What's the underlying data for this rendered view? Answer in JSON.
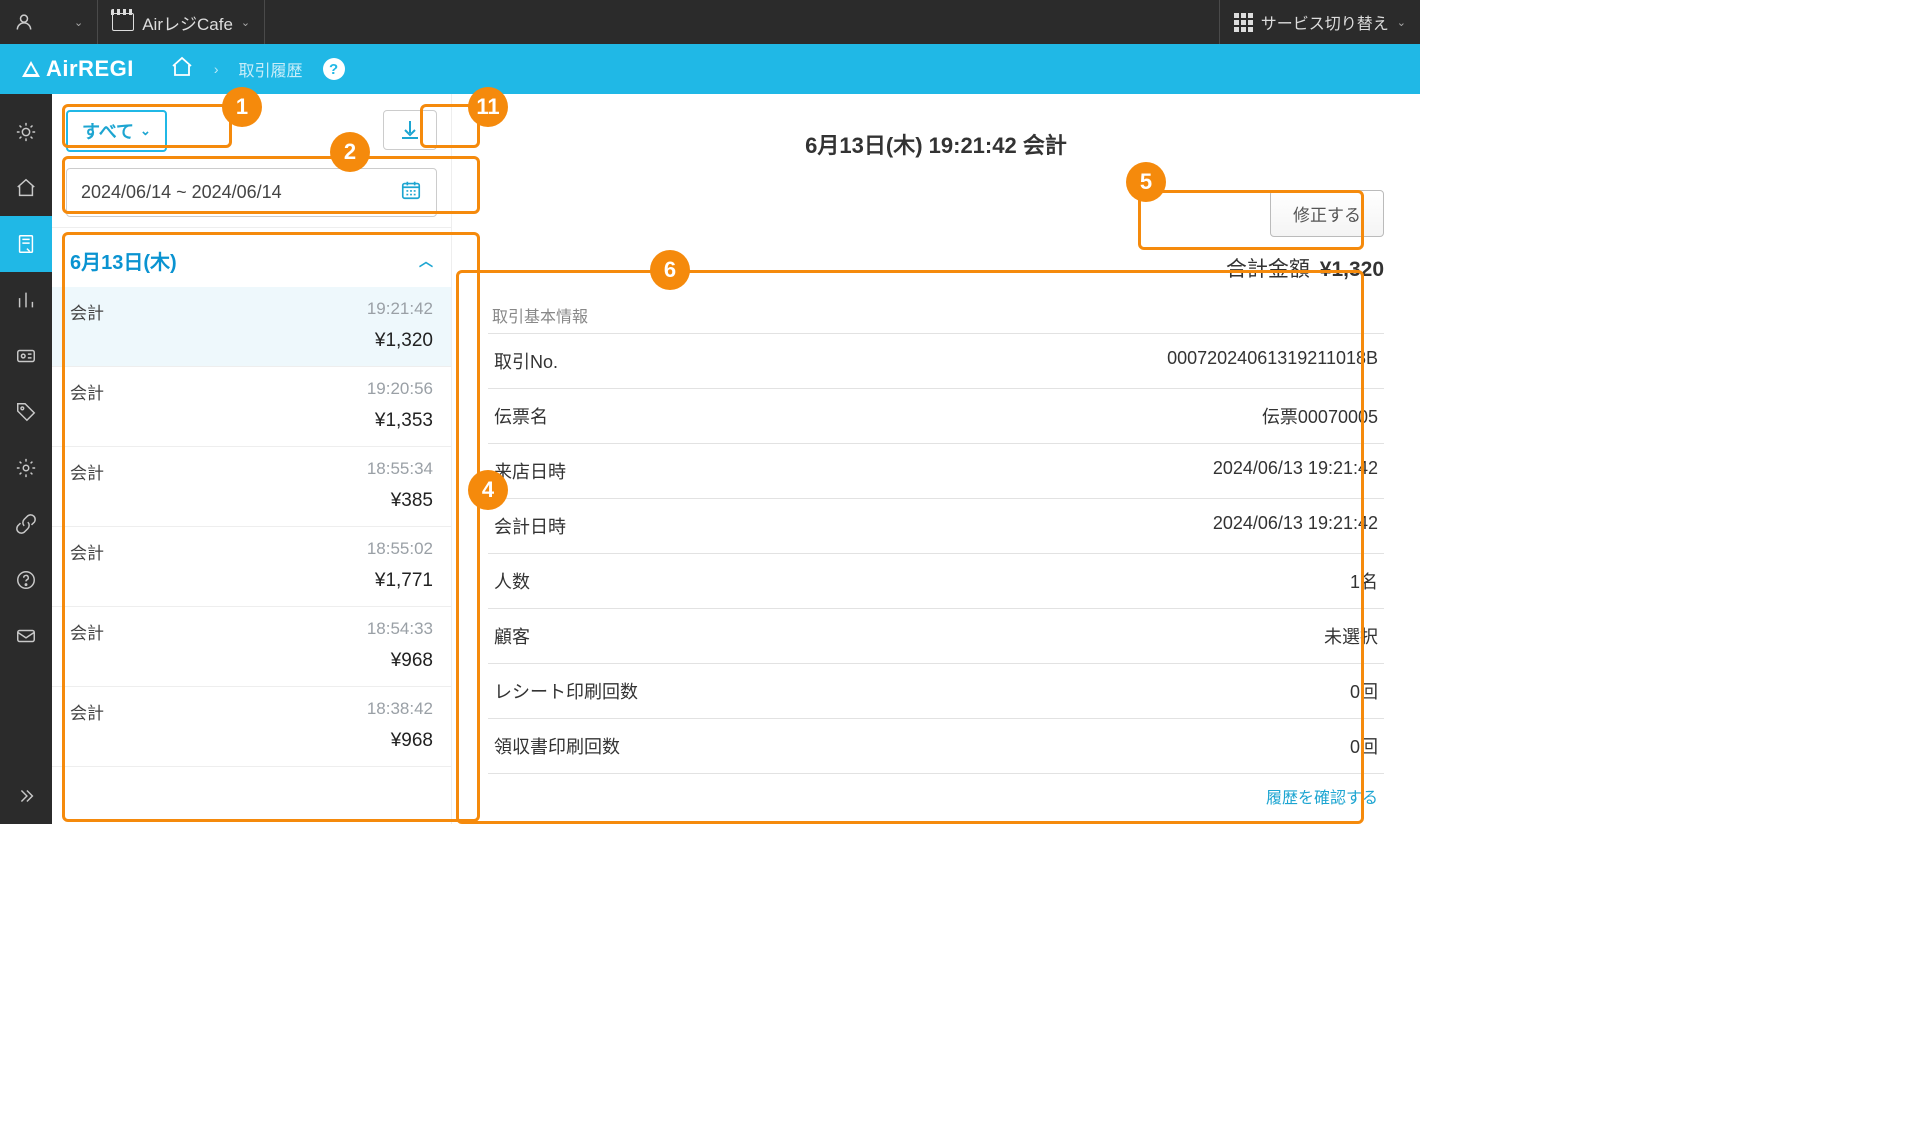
{
  "top": {
    "store_name": "AirレジCafe",
    "service_switch": "サービス切り替え"
  },
  "breadcrumb": {
    "brand": "AirREGI",
    "current": "取引履歴"
  },
  "filters": {
    "all_label": "すべて",
    "date_range": "2024/06/14 ~ 2024/06/14"
  },
  "date_group": {
    "label": "6月13日(木)"
  },
  "transactions": [
    {
      "type": "会計",
      "time": "19:21:42",
      "amount": "¥1,320",
      "selected": true
    },
    {
      "type": "会計",
      "time": "19:20:56",
      "amount": "¥1,353",
      "selected": false
    },
    {
      "type": "会計",
      "time": "18:55:34",
      "amount": "¥385",
      "selected": false
    },
    {
      "type": "会計",
      "time": "18:55:02",
      "amount": "¥1,771",
      "selected": false
    },
    {
      "type": "会計",
      "time": "18:54:33",
      "amount": "¥968",
      "selected": false
    },
    {
      "type": "会計",
      "time": "18:38:42",
      "amount": "¥968",
      "selected": false
    }
  ],
  "detail": {
    "title": "6月13日(木) 19:21:42 会計",
    "edit_button": "修正する",
    "total_label": "合計金額",
    "total_amount": "¥1,320",
    "section_title": "取引基本情報",
    "rows": [
      {
        "label": "取引No.",
        "value": "00072024061319211018B"
      },
      {
        "label": "伝票名",
        "value": "伝票00070005"
      },
      {
        "label": "来店日時",
        "value": "2024/06/13 19:21:42"
      },
      {
        "label": "会計日時",
        "value": "2024/06/13 19:21:42"
      },
      {
        "label": "人数",
        "value": "1名"
      },
      {
        "label": "顧客",
        "value": "未選択"
      },
      {
        "label": "レシート印刷回数",
        "value": "0回"
      },
      {
        "label": "領収書印刷回数",
        "value": "0回"
      }
    ],
    "history_link": "履歴を確認する"
  },
  "callouts": {
    "c1": "1",
    "c2": "2",
    "c4": "4",
    "c5": "5",
    "c6": "6",
    "c11": "11"
  }
}
